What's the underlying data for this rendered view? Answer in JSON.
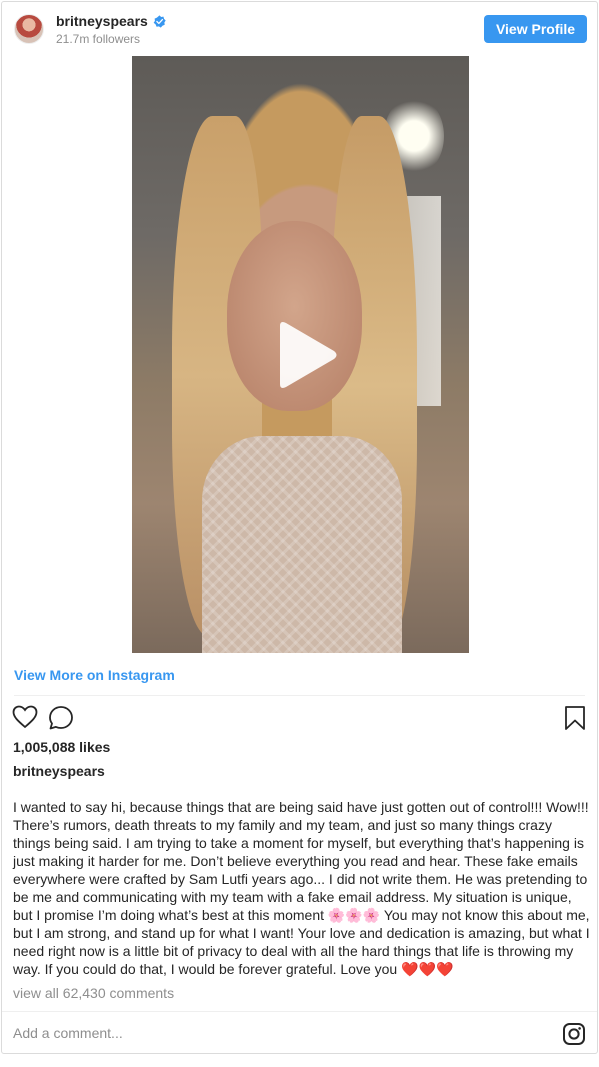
{
  "header": {
    "username": "britneyspears",
    "followers": "21.7m followers",
    "view_profile_label": "View Profile"
  },
  "media": {
    "type": "video",
    "play_icon": "play-icon"
  },
  "view_more_label": "View More on Instagram",
  "actions": {
    "icons": [
      "heart-icon",
      "comment-icon",
      "bookmark-icon"
    ]
  },
  "post": {
    "likes": "1,005,088 likes",
    "author": "britneyspears",
    "caption": "I wanted to say hi, because things that are being said have just gotten out of control!!! Wow!!! There’s rumors, death threats to my family and my team, and just so many things crazy things being said. I am trying to take a moment for myself, but everything that’s happening is just making it harder for me. Don’t believe everything you read and hear. These fake emails everywhere were crafted by Sam Lutfi years ago... I did not write them. He was pretending to be me and communicating with my team with a fake email address. My situation is unique, but I promise I’m doing what’s best at this moment 🌸🌸🌸 You may not know this about me, but I am strong, and stand up for what I want! Your love and dedication is amazing, but what I need right now is a little bit of privacy to deal with all the hard things that life is throwing my way. If you could do that, I would be forever grateful. Love you ❤️❤️❤️",
    "view_all_comments": "view all 62,430 comments"
  },
  "comment_box": {
    "placeholder": "Add a comment..."
  },
  "colors": {
    "accent": "#3897f0",
    "muted": "#8e8e8e",
    "text": "#262626",
    "border": "#dbdbdb"
  }
}
